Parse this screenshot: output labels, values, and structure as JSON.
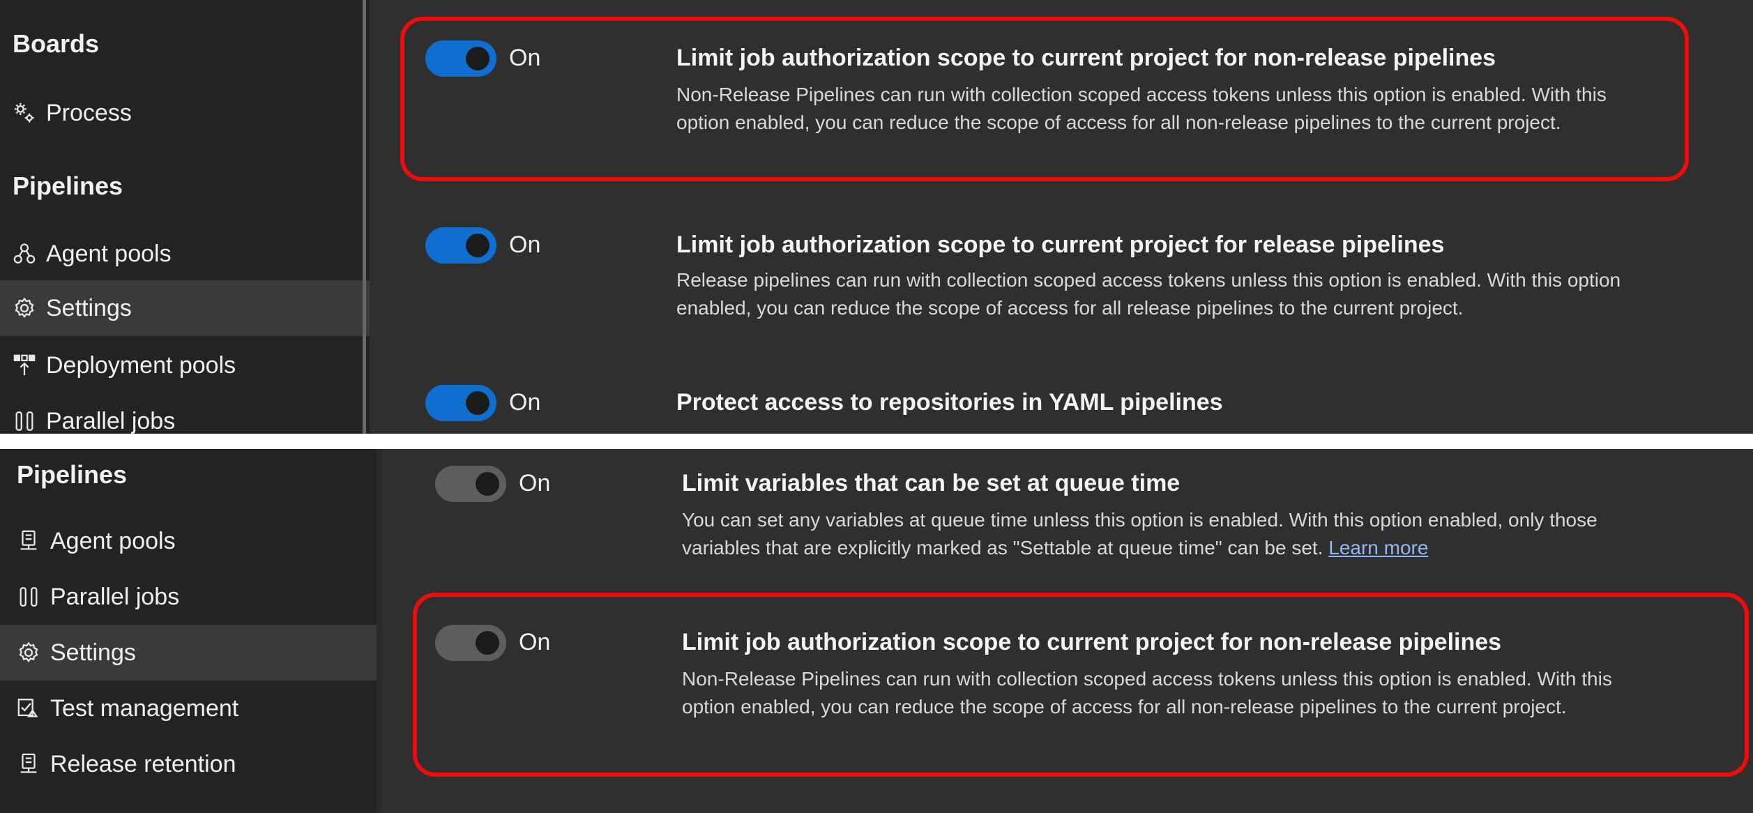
{
  "top_panel": {
    "sidebar": {
      "heading_boards": "Boards",
      "process": {
        "label": "Process",
        "icon": "gears-icon"
      },
      "heading_pipelines": "Pipelines",
      "items": [
        {
          "label": "Agent pools",
          "icon": "agent-pools-icon"
        },
        {
          "label": "Settings",
          "icon": "gear-icon",
          "selected": true
        },
        {
          "label": "Deployment pools",
          "icon": "deployment-pools-icon"
        },
        {
          "label": "Parallel jobs",
          "icon": "parallel-jobs-icon"
        }
      ]
    },
    "settings": [
      {
        "toggle": "On",
        "enabled": true,
        "title": "Limit job authorization scope to current project for non-release pipelines",
        "description": "Non-Release Pipelines can run with collection scoped access tokens unless this option is enabled. With this option enabled, you can reduce the scope of access for all non-release pipelines to the current project.",
        "highlighted": true
      },
      {
        "toggle": "On",
        "enabled": true,
        "title": "Limit job authorization scope to current project for release pipelines",
        "description": "Release pipelines can run with collection scoped access tokens unless this option is enabled. With this option enabled, you can reduce the scope of access for all release pipelines to the current project."
      },
      {
        "toggle": "On",
        "enabled": true,
        "title": "Protect access to repositories in YAML pipelines"
      }
    ]
  },
  "bottom_panel": {
    "sidebar": {
      "heading_pipelines": "Pipelines",
      "items": [
        {
          "label": "Agent pools",
          "icon": "agent-pools-icon"
        },
        {
          "label": "Parallel jobs",
          "icon": "parallel-jobs-icon"
        },
        {
          "label": "Settings",
          "icon": "gear-icon",
          "selected": true
        },
        {
          "label": "Test management",
          "icon": "test-management-icon"
        },
        {
          "label": "Release retention",
          "icon": "release-retention-icon"
        }
      ]
    },
    "settings": [
      {
        "toggle": "On",
        "enabled": false,
        "title": "Limit variables that can be set at queue time",
        "description": "You can set any variables at queue time unless this option is enabled. With this option enabled, only those variables that are explicitly marked as \"Settable at queue time\" can be set.",
        "link": "Learn more"
      },
      {
        "toggle": "On",
        "enabled": false,
        "title": "Limit job authorization scope to current project for non-release pipelines",
        "description": "Non-Release Pipelines can run with collection scoped access tokens unless this option is enabled. With this option enabled, you can reduce the scope of access for all non-release pipelines to the current project.",
        "highlighted": true
      }
    ]
  },
  "colors": {
    "toggle_on": "#0f6fd1",
    "toggle_off": "#5e5e5e",
    "highlight_border": "#ee0c0c",
    "link": "#8fb8f5"
  }
}
